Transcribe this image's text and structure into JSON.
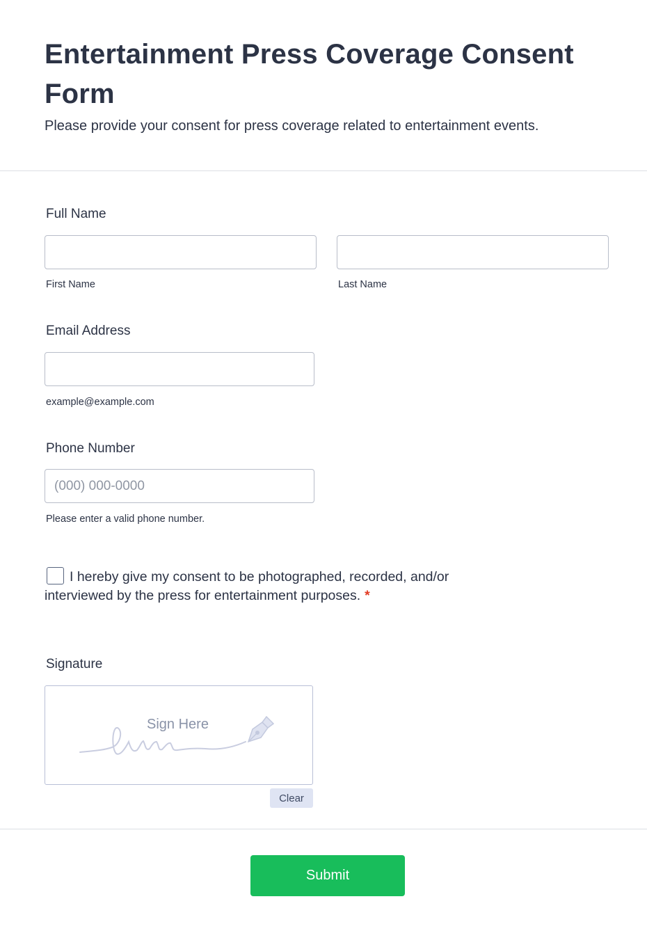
{
  "form": {
    "title": "Entertainment Press Coverage Consent Form",
    "subtitle": "Please provide your consent for press coverage related to entertainment events."
  },
  "full_name": {
    "label": "Full Name",
    "first": {
      "sublabel": "First Name",
      "value": ""
    },
    "last": {
      "sublabel": "Last Name",
      "value": ""
    }
  },
  "email": {
    "label": "Email Address",
    "value": "",
    "sublabel": "example@example.com"
  },
  "phone": {
    "label": "Phone Number",
    "value": "",
    "placeholder": "(000) 000-0000",
    "sublabel": "Please enter a valid phone number."
  },
  "consent": {
    "text": "I hereby give my consent to be photographed, recorded, and/or interviewed by the press for entertainment purposes.",
    "required_mark": "*",
    "checked": false
  },
  "signature": {
    "label": "Signature",
    "placeholder": "Sign Here",
    "clear_label": "Clear"
  },
  "submit_label": "Submit",
  "colors": {
    "submit_bg": "#18bd5b",
    "required": "#e23d25",
    "clear_bg": "#dfe4f3"
  },
  "icons": {
    "signature_pen": "pen-nib-icon",
    "signature_scribble": "signature-scribble"
  }
}
